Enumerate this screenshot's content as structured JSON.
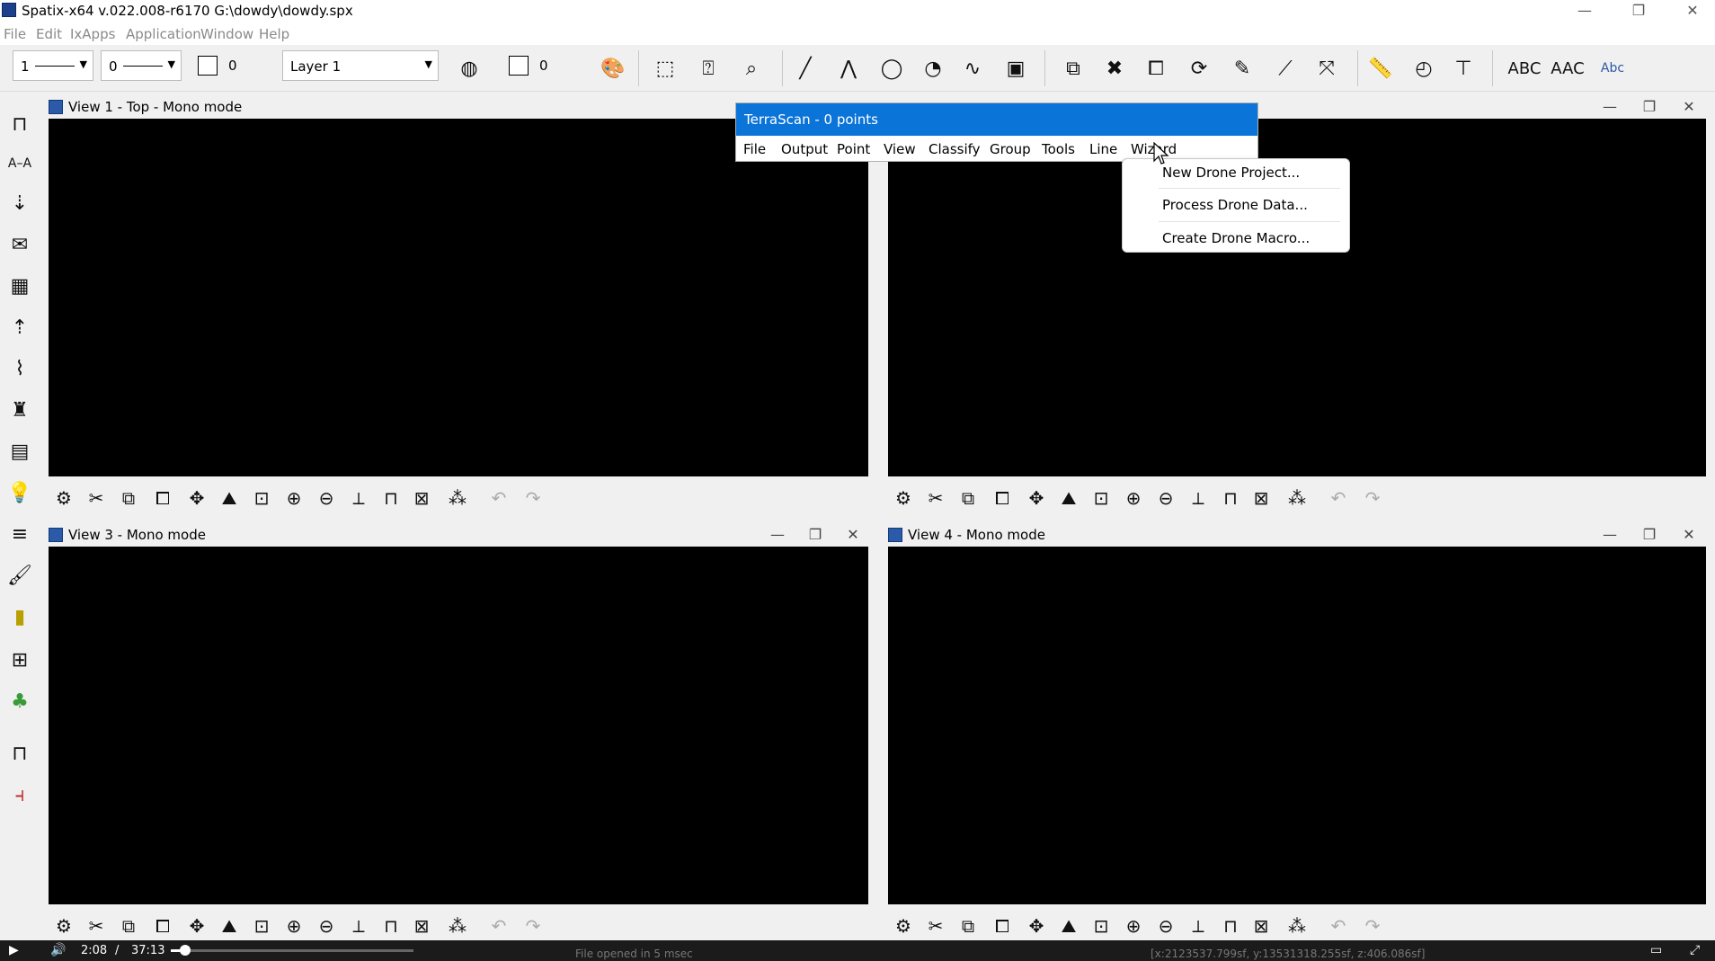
{
  "window": {
    "title": "Spatix-x64 v.022.008-r6170  G:\\dowdy\\dowdy.spx",
    "controls": {
      "minimize": "—",
      "restore": "❐",
      "close": "✕"
    }
  },
  "menubar": {
    "items": [
      "File",
      "Edit",
      "IxApps",
      "Application",
      "Window",
      "Help"
    ]
  },
  "toolbar": {
    "line_weight": "1",
    "line_style": "0",
    "color_value": "0",
    "fill_value": "0",
    "layer": "Layer 1",
    "text_tools": [
      "ABC",
      "AAC",
      "Abc"
    ]
  },
  "views": [
    {
      "title": "View 1 - Top - Mono mode"
    },
    {
      "title": ""
    },
    {
      "title": "View 3 - Mono mode"
    },
    {
      "title": "View 4 - Mono mode"
    }
  ],
  "terrascan": {
    "title": "TerraScan - 0 points",
    "menu": [
      "File",
      "Output",
      "Point",
      "View",
      "Classify",
      "Group",
      "Tools",
      "Line",
      "Wizard"
    ],
    "wizard_menu": [
      "New Drone Project...",
      "Process Drone Data...",
      "Create Drone Macro..."
    ]
  },
  "media": {
    "current_time": "2:08",
    "separator": "/",
    "total_time": "37:13",
    "progress": 0.0575
  },
  "status": {
    "message": "File opened in 5 msec",
    "coords": "[x:2123537.799sf, y:13531318.255sf, z:406.086sf]"
  },
  "colors": {
    "accent": "#0a74d8",
    "canvas": "#000000"
  }
}
